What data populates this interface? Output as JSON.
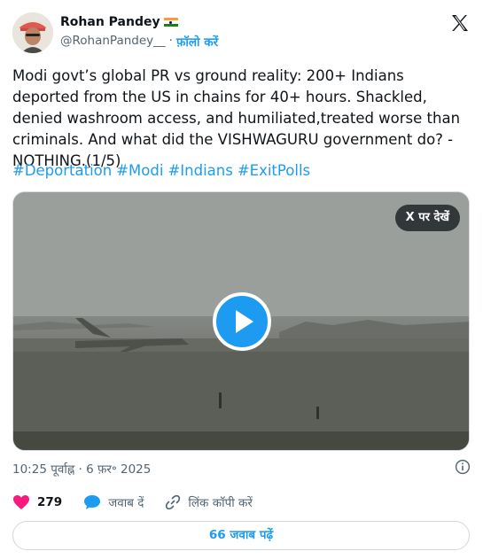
{
  "author": {
    "name": "Rohan Pandey",
    "handle": "@RohanPandey__",
    "separator": "·",
    "follow_label": "फ़ॉलो करें",
    "flag_icon": "india-flag-icon"
  },
  "tweet": {
    "text": "Modi govt’s global PR vs ground reality: 200+ Indians deported from the US in chains for 40+ hours. Shackled, denied washroom access, and humiliated,treated worse than criminals. And what did the VISHWAGURU government do? - NOTHING.(1/5)",
    "hashtags": [
      "#Deportation",
      "#Modi",
      "#Indians",
      "#ExitPolls"
    ]
  },
  "media": {
    "view_on_x_label": "X पर देखें",
    "play_icon": "play-icon"
  },
  "meta": {
    "timestamp": "10:25 पूर्वाह्न · 6 फ़र॰ 2025"
  },
  "actions": {
    "likes": "279",
    "reply_label": "जवाब दें",
    "copy_link_label": "लिंक कॉपी करें"
  },
  "footer": {
    "replies_label": "66 जवाब पढ़ें"
  },
  "colors": {
    "accent": "#1d9bf0",
    "like": "#f91880",
    "text": "#0f1419",
    "muted": "#536471"
  }
}
